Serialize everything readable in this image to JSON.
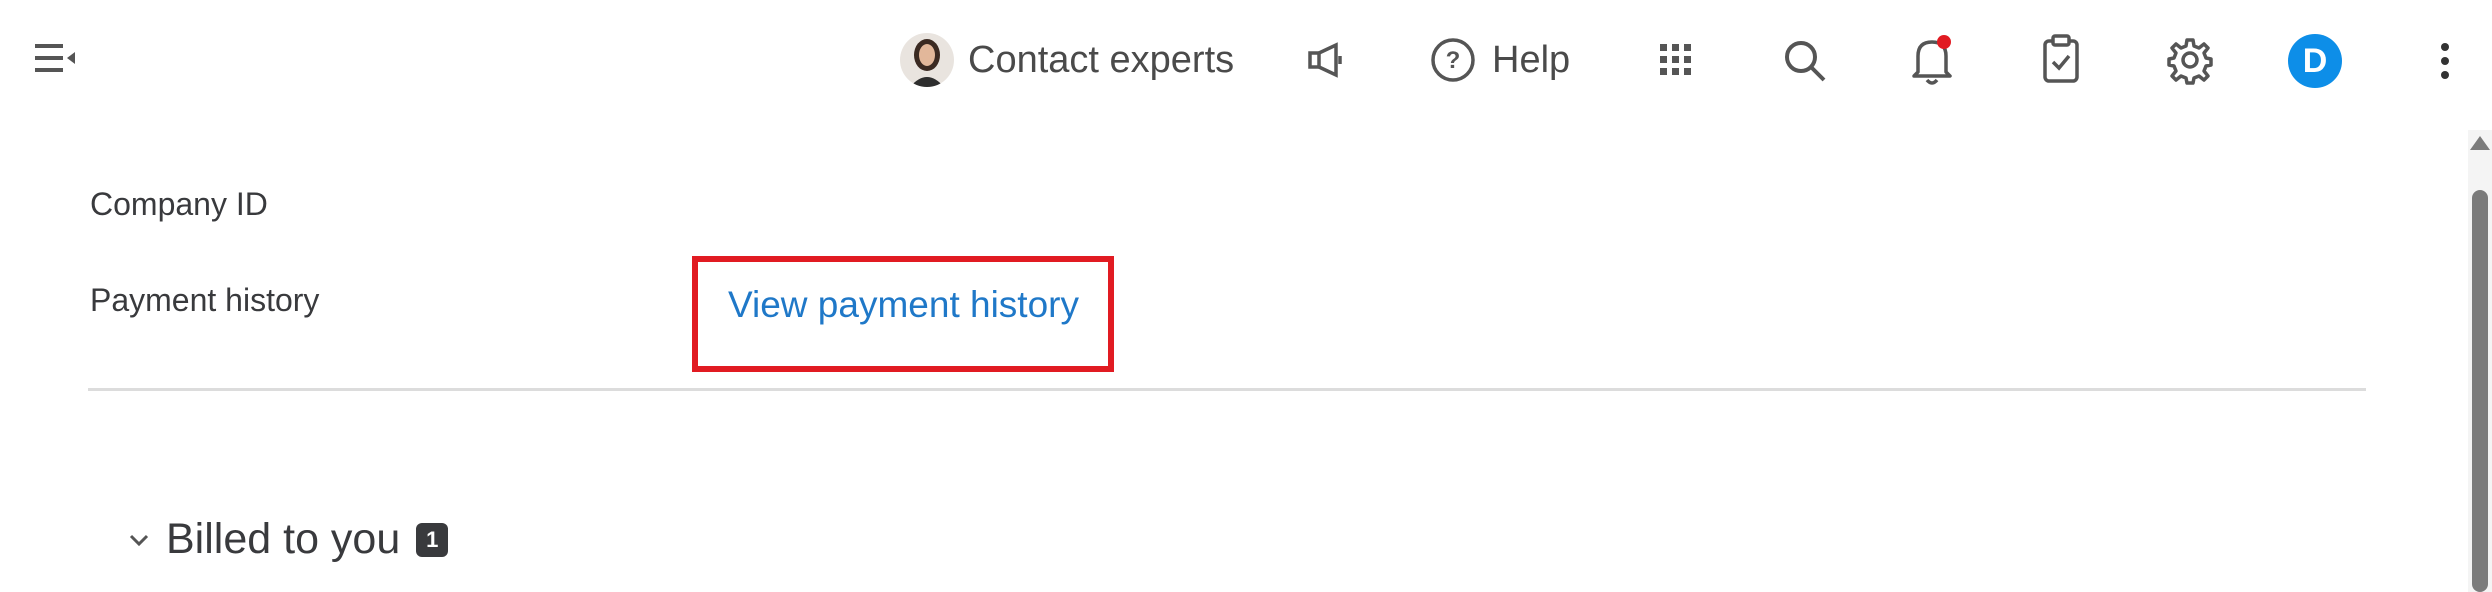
{
  "topbar": {
    "menu_icon": "collapse-menu-icon",
    "contact_experts_label": "Contact experts",
    "announcements_icon": "megaphone-icon",
    "help_label": "Help",
    "apps_icon": "grid-apps-icon",
    "search_icon": "search-icon",
    "notifications_icon": "bell-icon",
    "tasks_icon": "clipboard-check-icon",
    "settings_icon": "gear-icon",
    "avatar_initial": "D",
    "more_icon": "kebab-icon",
    "notification_dot_color": "#e11b22",
    "avatar_color": "#0d8ee8"
  },
  "details": {
    "company_id_label": "Company ID",
    "payment_history_label": "Payment history",
    "view_payment_history_link": "View payment history",
    "highlight_color": "#e11b22"
  },
  "billed": {
    "title": "Billed to you",
    "count": "1"
  }
}
